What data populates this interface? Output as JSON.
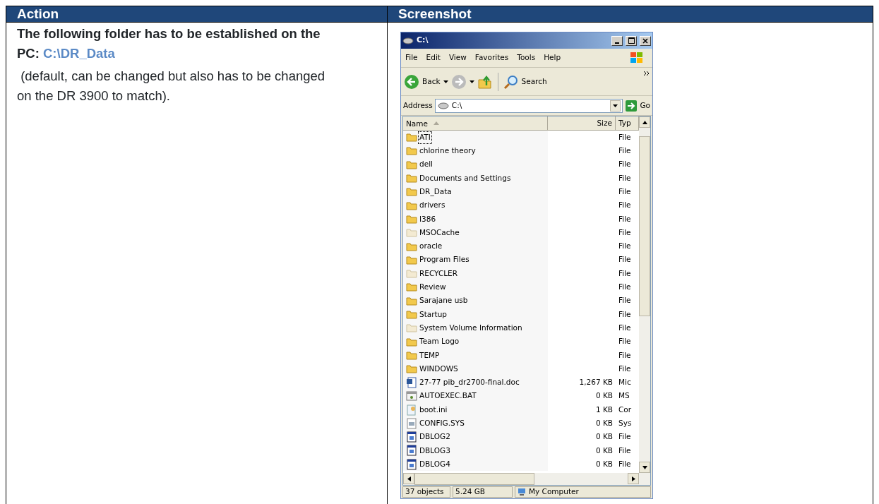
{
  "table": {
    "columns": [
      "Action",
      "Screenshot"
    ],
    "action": {
      "lead": "The following folder has to be established on the PC:",
      "path": "C:\\DR_Data",
      "note": " (default, can be changed but also has to be changed on the DR 3900 to match)."
    },
    "screenshot": {
      "window": {
        "title": "C:\\",
        "menu": [
          "File",
          "Edit",
          "View",
          "Favorites",
          "Tools",
          "Help"
        ],
        "toolbar": {
          "back": "Back",
          "search": "Search"
        },
        "address": {
          "label": "Address",
          "value": "C:\\",
          "go": "Go"
        },
        "columns": [
          "Name",
          "Size",
          "Typ"
        ],
        "rows": [
          {
            "name": "ATI",
            "size": "",
            "type": "File",
            "kind": "folder",
            "focused": true
          },
          {
            "name": "chlorine theory",
            "size": "",
            "type": "File",
            "kind": "folder",
            "focused": false
          },
          {
            "name": "dell",
            "size": "",
            "type": "File",
            "kind": "folder",
            "focused": false
          },
          {
            "name": "Documents and Settings",
            "size": "",
            "type": "File",
            "kind": "folder",
            "focused": false
          },
          {
            "name": "DR_Data",
            "size": "",
            "type": "File",
            "kind": "folder",
            "focused": false
          },
          {
            "name": "drivers",
            "size": "",
            "type": "File",
            "kind": "folder",
            "focused": false
          },
          {
            "name": "I386",
            "size": "",
            "type": "File",
            "kind": "folder",
            "focused": false
          },
          {
            "name": "MSOCache",
            "size": "",
            "type": "File",
            "kind": "hidden-folder",
            "focused": false
          },
          {
            "name": "oracle",
            "size": "",
            "type": "File",
            "kind": "folder",
            "focused": false
          },
          {
            "name": "Program Files",
            "size": "",
            "type": "File",
            "kind": "folder",
            "focused": false
          },
          {
            "name": "RECYCLER",
            "size": "",
            "type": "File",
            "kind": "hidden-folder",
            "focused": false
          },
          {
            "name": "Review",
            "size": "",
            "type": "File",
            "kind": "folder",
            "focused": false
          },
          {
            "name": "Sarajane usb",
            "size": "",
            "type": "File",
            "kind": "folder",
            "focused": false
          },
          {
            "name": "Startup",
            "size": "",
            "type": "File",
            "kind": "folder",
            "focused": false
          },
          {
            "name": "System Volume Information",
            "size": "",
            "type": "File",
            "kind": "hidden-folder",
            "focused": false
          },
          {
            "name": "Team Logo",
            "size": "",
            "type": "File",
            "kind": "folder",
            "focused": false
          },
          {
            "name": "TEMP",
            "size": "",
            "type": "File",
            "kind": "folder",
            "focused": false
          },
          {
            "name": "WINDOWS",
            "size": "",
            "type": "File",
            "kind": "folder",
            "focused": false
          },
          {
            "name": "27-77 pib_dr2700-final.doc",
            "size": "1,267 KB",
            "type": "Mic",
            "kind": "document",
            "focused": false
          },
          {
            "name": "AUTOEXEC.BAT",
            "size": "0 KB",
            "type": "MS",
            "kind": "batch",
            "focused": false
          },
          {
            "name": "boot.ini",
            "size": "1 KB",
            "type": "Cor",
            "kind": "settings",
            "focused": false
          },
          {
            "name": "CONFIG.SYS",
            "size": "0 KB",
            "type": "Sys",
            "kind": "system",
            "focused": false
          },
          {
            "name": "DBLOG2",
            "size": "0 KB",
            "type": "File",
            "kind": "log",
            "focused": false
          },
          {
            "name": "DBLOG3",
            "size": "0 KB",
            "type": "File",
            "kind": "log",
            "focused": false
          },
          {
            "name": "DBLOG4",
            "size": "0 KB",
            "type": "File",
            "kind": "log",
            "focused": false
          }
        ],
        "status": [
          "37 objects",
          "5.24 GB",
          "My Computer"
        ]
      }
    }
  }
}
